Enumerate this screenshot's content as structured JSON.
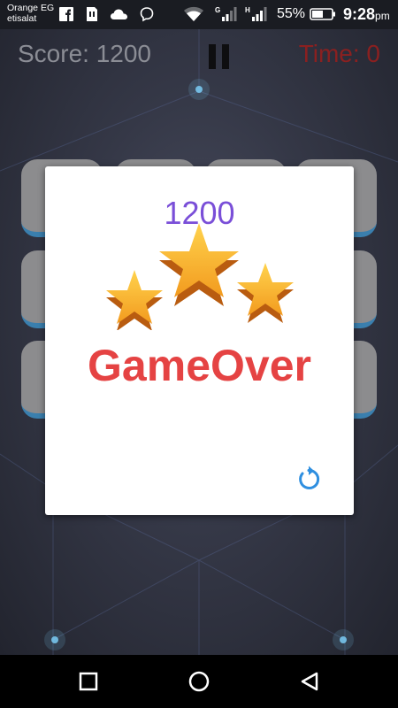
{
  "status_bar": {
    "carrier_line1": "Orange EG",
    "carrier_line2": "etisalat",
    "battery_percent": "55%",
    "time": "9:28",
    "time_suffix": "pm",
    "icons": [
      "facebook-icon",
      "sim-card-icon",
      "cloud-icon",
      "messenger-icon",
      "wifi-icon",
      "signal-g-icon",
      "signal-h-icon",
      "battery-icon"
    ]
  },
  "hud": {
    "score_text": "Score: 1200",
    "time_text": "Time: 0",
    "pause_icon": "pause-icon"
  },
  "dialog": {
    "final_score": "1200",
    "stars_earned": 3,
    "title": "GameOver",
    "replay_icon": "replay-icon"
  },
  "nav_bar": {
    "icons": [
      "recent-apps-icon",
      "home-icon",
      "back-icon"
    ]
  },
  "colors": {
    "score_gray": "#8b8d95",
    "time_red": "#8a2020",
    "final_score_purple": "#7a4fd8",
    "gameover_red": "#e54343",
    "replay_blue": "#2f8fe0",
    "star_gold": "#f7b733",
    "tile_gray": "#8c8c8e",
    "tile_blue_edge": "#3a7fae"
  }
}
